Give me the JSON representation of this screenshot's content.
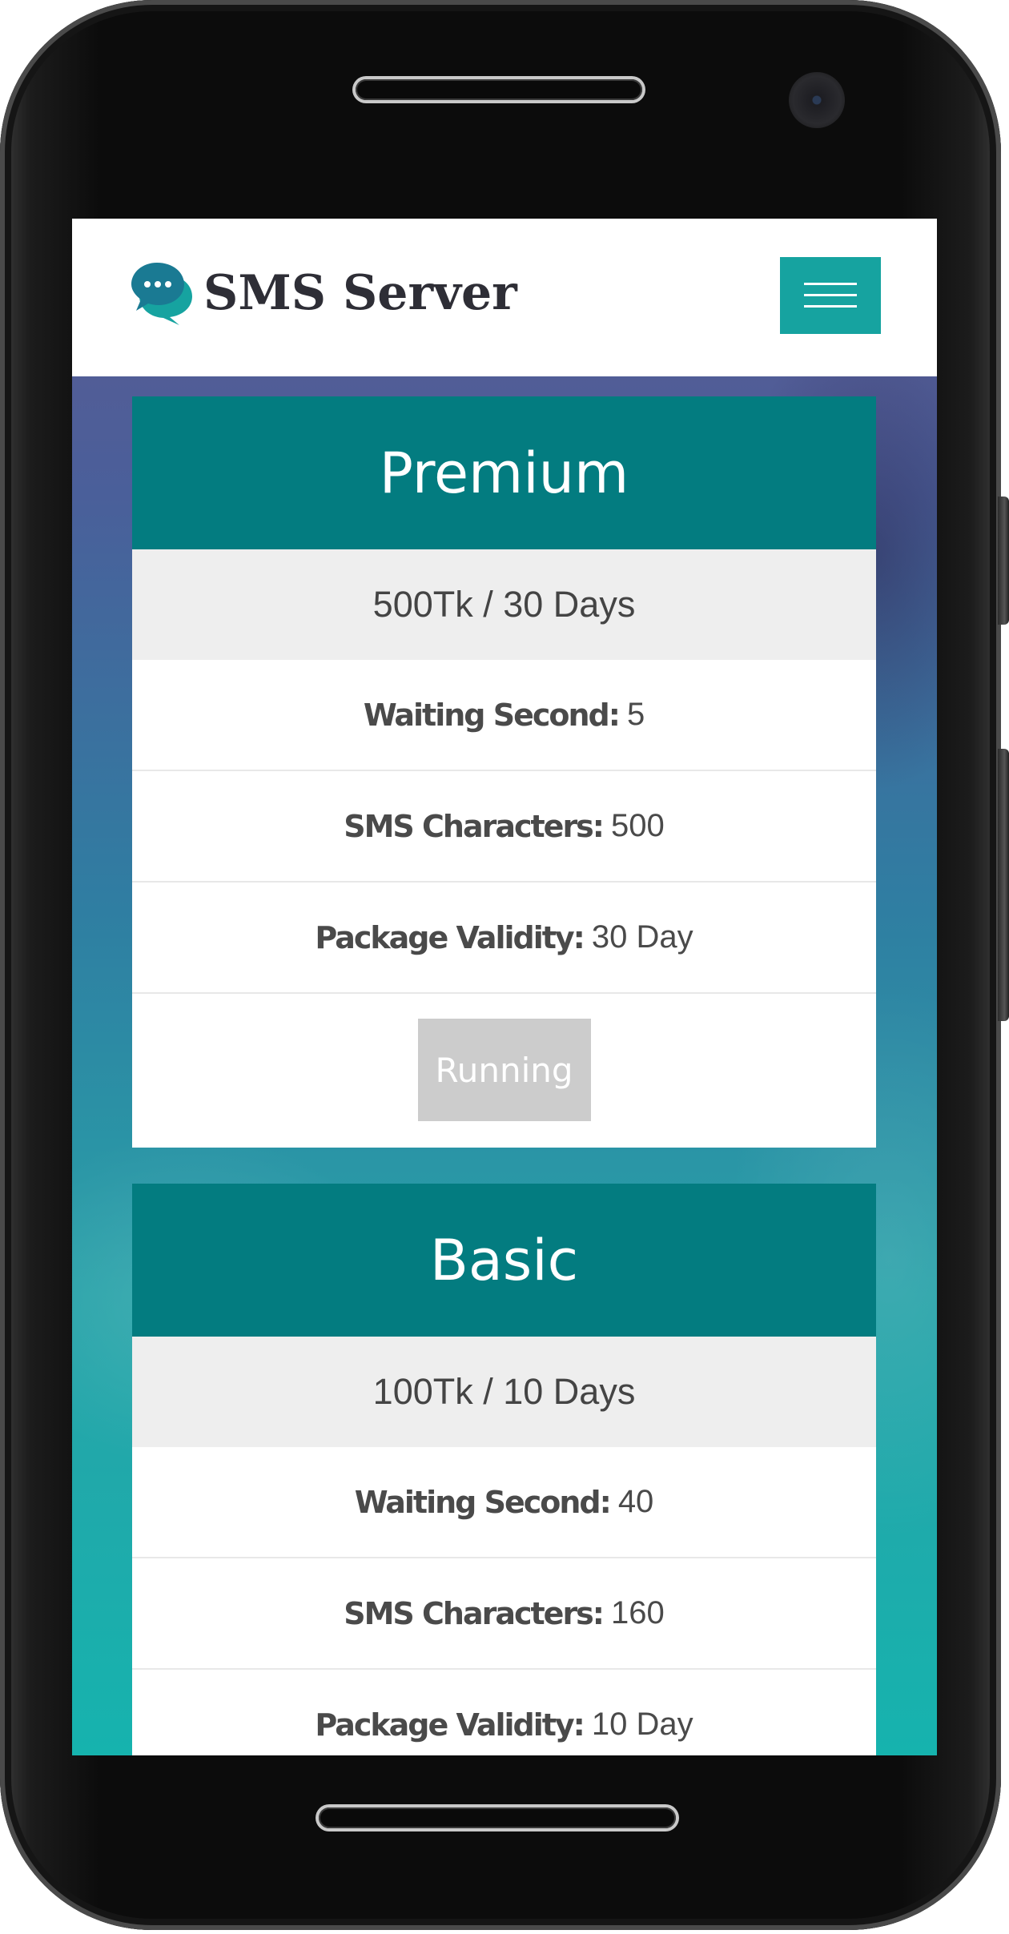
{
  "header": {
    "brand": "SMS Server",
    "menu_icon": "hamburger-menu-icon",
    "logo_icon": "chat-bubbles-icon"
  },
  "colors": {
    "accent": "#16a3a0",
    "card_header": "#037c80",
    "price_band": "#eeeeee",
    "button_disabled": "#cccccc"
  },
  "packages": [
    {
      "name": "Premium",
      "price": "500Tk / 30 Days",
      "rows": [
        {
          "label": "Waiting Second:",
          "value": "5"
        },
        {
          "label": "SMS Characters:",
          "value": "500"
        },
        {
          "label": "Package Validity:",
          "value": "30 Day"
        }
      ],
      "button_label": "Running"
    },
    {
      "name": "Basic",
      "price": "100Tk / 10 Days",
      "rows": [
        {
          "label": "Waiting Second:",
          "value": "40"
        },
        {
          "label": "SMS Characters:",
          "value": "160"
        },
        {
          "label": "Package Validity:",
          "value": "10 Day"
        }
      ]
    }
  ]
}
